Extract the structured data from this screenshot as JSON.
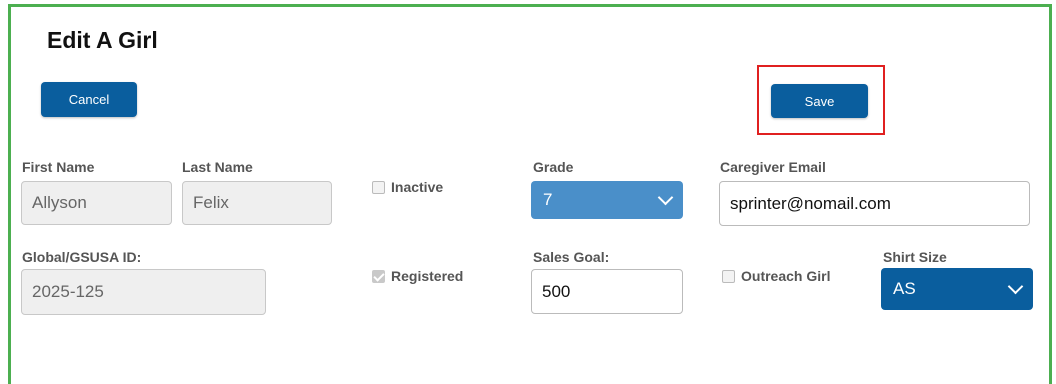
{
  "page": {
    "title": "Edit A Girl"
  },
  "actions": {
    "cancel_label": "Cancel",
    "save_label": "Save"
  },
  "fields": {
    "first_name": {
      "label": "First Name",
      "value": "Allyson"
    },
    "last_name": {
      "label": "Last Name",
      "value": "Felix"
    },
    "inactive": {
      "label": "Inactive",
      "checked": false
    },
    "grade": {
      "label": "Grade",
      "value": "7"
    },
    "caregiver_email": {
      "label": "Caregiver Email",
      "value": "sprinter@nomail.com"
    },
    "global_id": {
      "label": "Global/GSUSA ID:",
      "value": "2025-125"
    },
    "registered": {
      "label": "Registered",
      "checked": true
    },
    "sales_goal": {
      "label": "Sales Goal:",
      "value": "500"
    },
    "outreach_girl": {
      "label": "Outreach Girl",
      "checked": false
    },
    "shirt_size": {
      "label": "Shirt Size",
      "value": "AS"
    }
  },
  "colors": {
    "frame": "#4caf50",
    "button": "#0a5e9e",
    "highlight": "#e02020",
    "grade_select": "#4a8fc9",
    "shirt_select": "#0a5e9e"
  }
}
